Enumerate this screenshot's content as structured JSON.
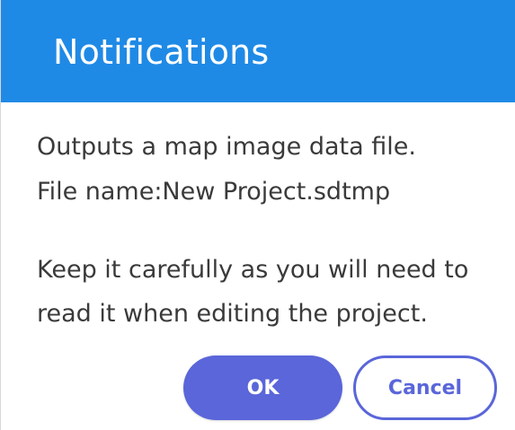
{
  "dialog": {
    "title": "Notifications",
    "lines": [
      "Outputs a map image data file.",
      "File name:New Project.sdtmp",
      "Keep it carefully as you will need to",
      "read it when editing the project."
    ],
    "ok_label": "OK",
    "cancel_label": "Cancel"
  },
  "colors": {
    "header": "#1f8ae6",
    "accent": "#5a66d9",
    "text": "#3a3a3a"
  }
}
